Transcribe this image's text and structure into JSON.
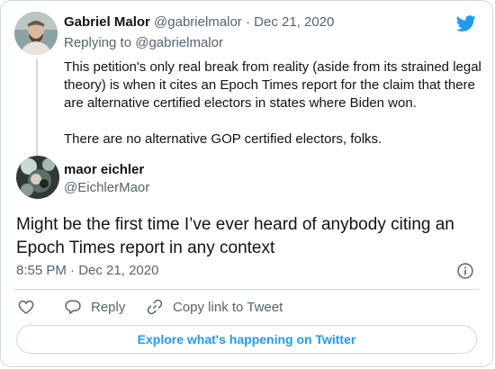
{
  "parent_tweet": {
    "author_name": "Gabriel Malor",
    "author_handle": "@gabrielmalor",
    "separator": "·",
    "date": "Dec 21, 2020",
    "replying_to": "Replying to @gabrielmalor",
    "paragraphs": [
      "This petition's only real break from reality (aside from its strained legal theory) is when it cites an Epoch Times report for the claim that there are alternative certified electors in states where Biden won.",
      "There are no alternative GOP certified electors, folks."
    ]
  },
  "main_tweet": {
    "author_name": "maor eichler",
    "author_handle": "@EichlerMaor",
    "text": "Might be the first time I’ve ever heard of anybody citing an Epoch Times report in any context",
    "time": "8:55 PM",
    "separator": "·",
    "date": "Dec 21, 2020"
  },
  "actions": {
    "reply_label": "Reply",
    "copy_label": "Copy link to Tweet"
  },
  "explore_label": "Explore what's happening on Twitter",
  "icons": {
    "brand": "twitter-bird-icon",
    "like": "heart-icon",
    "reply": "speech-bubble-icon",
    "copy": "link-icon",
    "info": "info-icon"
  },
  "colors": {
    "accent": "#1d9bf0",
    "text": "#0f1419",
    "muted": "#536471",
    "border": "#cfd9de"
  }
}
